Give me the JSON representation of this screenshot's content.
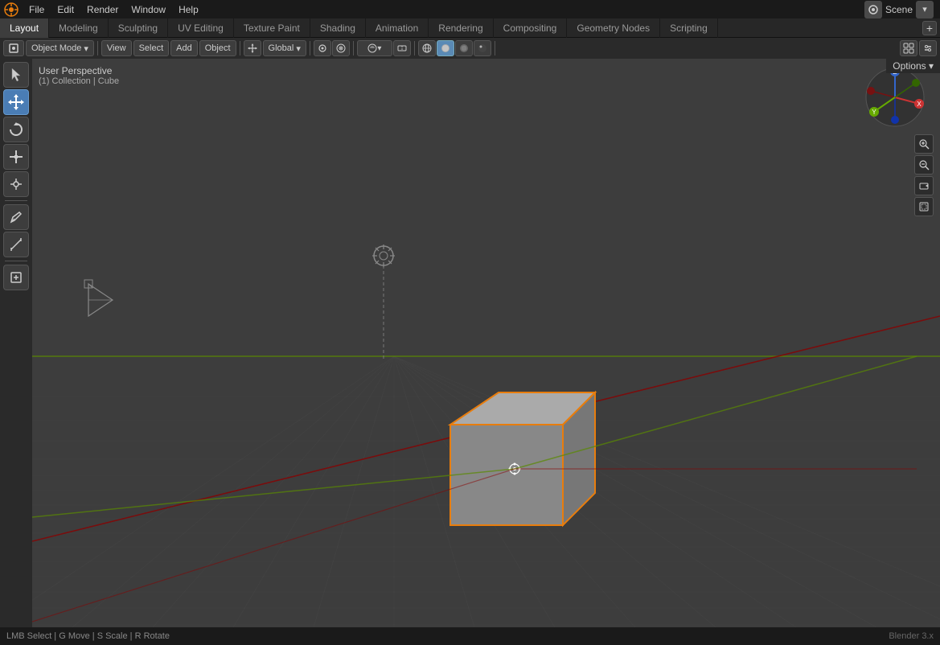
{
  "app": {
    "title": "Blender",
    "logo": "⬡"
  },
  "top_menu": {
    "items": [
      "File",
      "Edit",
      "Render",
      "Window",
      "Help"
    ]
  },
  "workspace_tabs": [
    {
      "label": "Layout",
      "active": true
    },
    {
      "label": "Modeling",
      "active": false
    },
    {
      "label": "Sculpting",
      "active": false
    },
    {
      "label": "UV Editing",
      "active": false
    },
    {
      "label": "Texture Paint",
      "active": false
    },
    {
      "label": "Shading",
      "active": false
    },
    {
      "label": "Animation",
      "active": false
    },
    {
      "label": "Rendering",
      "active": false
    },
    {
      "label": "Compositing",
      "active": false
    },
    {
      "label": "Geometry Nodes",
      "active": false
    },
    {
      "label": "Scripting",
      "active": false
    }
  ],
  "secondary_toolbar": {
    "mode_label": "Object Mode",
    "view_label": "View",
    "select_label": "Select",
    "add_label": "Add",
    "object_label": "Object",
    "transform_label": "Global",
    "options_label": "Options ▾"
  },
  "viewport": {
    "perspective_label": "User Perspective",
    "collection_label": "(1) Collection | Cube"
  },
  "scene": {
    "name": "Scene"
  },
  "left_tools": [
    {
      "icon": "⊕",
      "name": "cursor",
      "active": false
    },
    {
      "icon": "✥",
      "name": "move",
      "active": false
    },
    {
      "icon": "↻",
      "name": "rotate",
      "active": false
    },
    {
      "icon": "⤢",
      "name": "scale",
      "active": false
    },
    {
      "icon": "⟲",
      "name": "transform",
      "active": false
    },
    {
      "sep": true
    },
    {
      "icon": "✎",
      "name": "annotate",
      "active": false
    },
    {
      "icon": "⧖",
      "name": "measure",
      "active": false
    },
    {
      "sep": true
    },
    {
      "icon": "⊞",
      "name": "add-cube",
      "active": false
    }
  ],
  "status_bar": {
    "text": "LMB   Select   |   G  Move   |   S  Scale   |   R  Rotate"
  },
  "nav_axes": {
    "x_color": "#cc3333",
    "y_color": "#66aa00",
    "z_color": "#3366cc",
    "nx_color": "#771111",
    "ny_color": "#336600",
    "nz_color": "#1133aa"
  }
}
